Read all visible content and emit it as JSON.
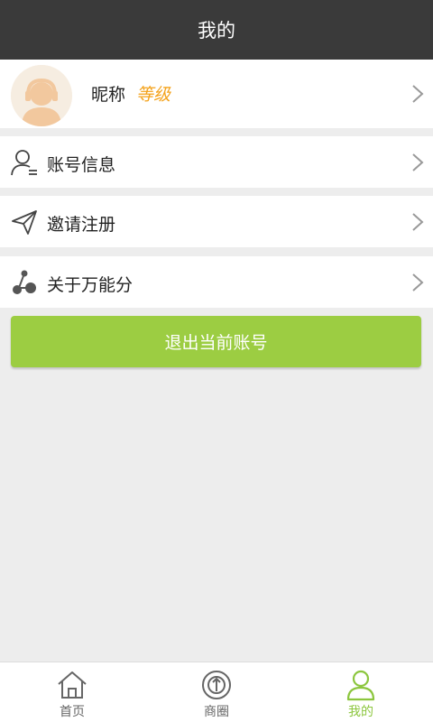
{
  "header": {
    "title": "我的"
  },
  "profile": {
    "nickname": "昵称",
    "level": "等级"
  },
  "menu": [
    {
      "label": "账号信息",
      "icon": "user-icon"
    },
    {
      "label": "邀请注册",
      "icon": "paper-plane-icon"
    },
    {
      "label": "关于万能分",
      "icon": "share-nodes-icon"
    }
  ],
  "logout": {
    "label": "退出当前账号"
  },
  "tabs": [
    {
      "label": "首页",
      "icon": "home-icon",
      "active": false
    },
    {
      "label": "商圈",
      "icon": "circle-icon",
      "active": false
    },
    {
      "label": "我的",
      "icon": "person-icon",
      "active": true
    }
  ],
  "colors": {
    "header_bg": "#3a3a3a",
    "accent_green": "#9ccd42",
    "level_orange": "#f4a21b",
    "background": "#ededed"
  }
}
